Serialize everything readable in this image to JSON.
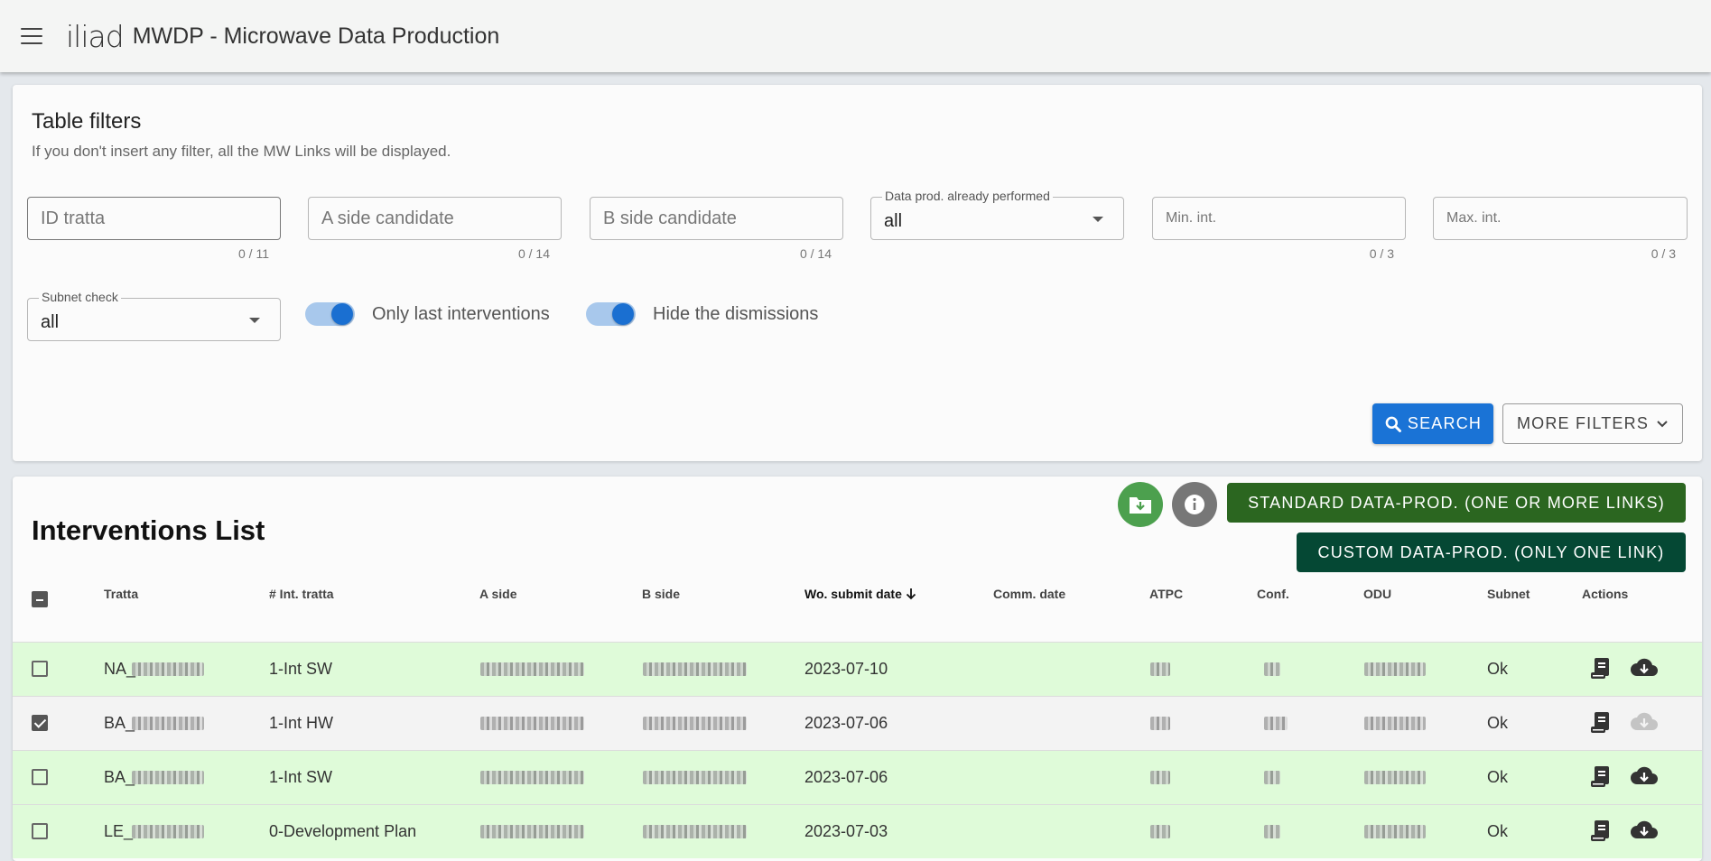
{
  "app": {
    "logo": "iliad",
    "title": "MWDP - Microwave Data Production"
  },
  "filters": {
    "title": "Table filters",
    "subtitle": "If you don't insert any filter, all the MW Links will be displayed.",
    "id_tratta": {
      "placeholder": "ID tratta",
      "value": "",
      "counter": "0 / 11"
    },
    "a_side": {
      "placeholder": "A side candidate",
      "value": "",
      "counter": "0 / 14"
    },
    "b_side": {
      "placeholder": "B side candidate",
      "value": "",
      "counter": "0 / 14"
    },
    "data_prod": {
      "label": "Data prod. already performed",
      "value": "all"
    },
    "min_int": {
      "placeholder": "Min. int.",
      "value": "",
      "counter": "0 / 3"
    },
    "max_int": {
      "placeholder": "Max. int.",
      "value": "",
      "counter": "0 / 3"
    },
    "subnet_check": {
      "label": "Subnet check",
      "value": "all"
    },
    "only_last": {
      "label": "Only last interventions",
      "on": true
    },
    "hide_dismissions": {
      "label": "Hide the dismissions",
      "on": true
    },
    "search_label": "SEARCH",
    "more_filters_label": "MORE FILTERS"
  },
  "list": {
    "title": "Interventions List",
    "standard_btn": "STANDARD DATA-PROD. (ONE OR MORE LINKS)",
    "custom_btn": "CUSTOM DATA-PROD. (ONLY ONE LINK)",
    "columns": {
      "tratta": "Tratta",
      "int_tratta": "# Int. tratta",
      "a_side": "A side",
      "b_side": "B side",
      "wo_submit": "Wo. submit date",
      "comm_date": "Comm. date",
      "atpc": "ATPC",
      "conf": "Conf.",
      "odu": "ODU",
      "subnet": "Subnet",
      "actions": "Actions"
    },
    "rows": [
      {
        "tratta": "NA_",
        "int": "1-Int SW",
        "date": "2023-07-10",
        "subnet": "Ok",
        "checked": false,
        "status": "green"
      },
      {
        "tratta": "BA_",
        "int": "1-Int HW",
        "date": "2023-07-06",
        "subnet": "Ok",
        "checked": true,
        "status": "grey"
      },
      {
        "tratta": "BA_",
        "int": "1-Int SW",
        "date": "2023-07-06",
        "subnet": "Ok",
        "checked": false,
        "status": "green"
      },
      {
        "tratta": "LE_",
        "int": "0-Development Plan",
        "date": "2023-07-03",
        "subnet": "Ok",
        "checked": false,
        "status": "green"
      }
    ]
  },
  "colors": {
    "primary": "#1a73d6",
    "standard_btn": "#2b6620",
    "custom_btn": "#054834",
    "row_ok": "#dffbd9"
  },
  "icons": [
    "menu-icon",
    "search-icon",
    "chevron-down-icon",
    "folder-download-icon",
    "info-icon",
    "document-icon",
    "cloud-download-icon"
  ]
}
